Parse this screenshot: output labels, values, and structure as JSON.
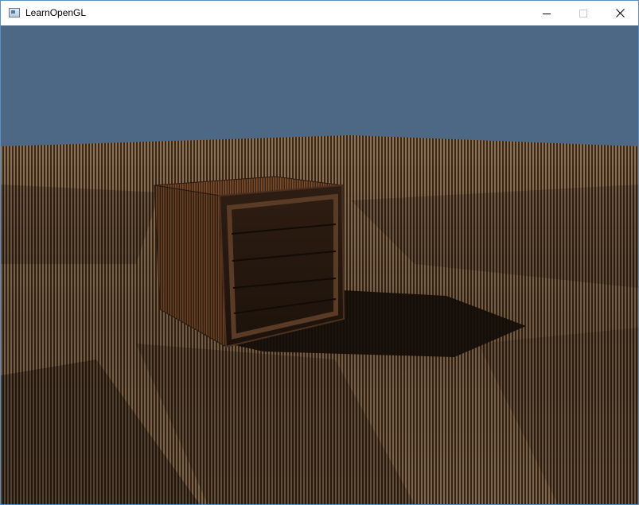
{
  "window": {
    "title": "LearnOpenGL",
    "icon": "app-window-icon",
    "buttons": {
      "minimize": "minimize-icon",
      "maximize": "maximize-icon",
      "close": "close-icon"
    }
  },
  "scene": {
    "sky_color": "#4d6885",
    "floor_color": "#7a5a3d",
    "crate_color": "#5a3a22"
  }
}
